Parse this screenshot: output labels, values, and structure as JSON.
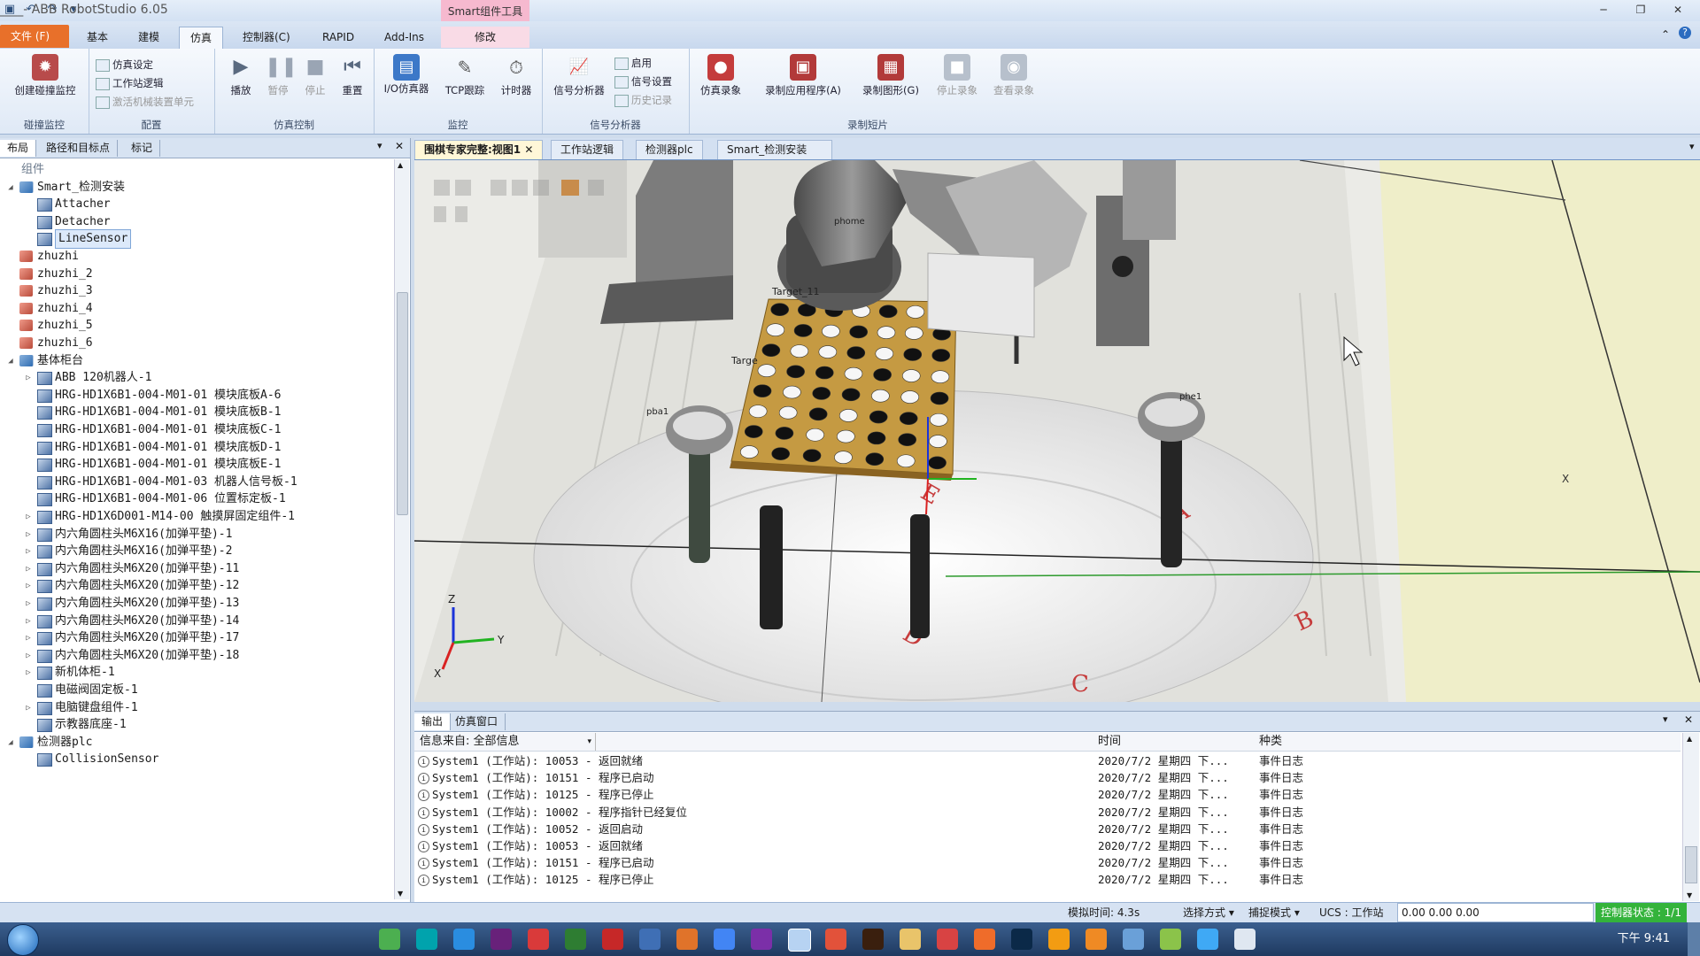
{
  "title_bar": {
    "doc_name": "________",
    "app_title": " - ABB RobotStudio 6.05",
    "context_group": "Smart组件工具",
    "quick_access": [
      "save-icon",
      "undo-icon",
      "redo-icon",
      "customize-icon"
    ]
  },
  "ribbon_tabs": [
    {
      "label": "文件 (F)"
    },
    {
      "label": "基本"
    },
    {
      "label": "建模"
    },
    {
      "label": "仿真"
    },
    {
      "label": "控制器(C)"
    },
    {
      "label": "RAPID"
    },
    {
      "label": "Add-Ins"
    },
    {
      "label": "修改"
    }
  ],
  "ribbon_groups": {
    "collision": {
      "label": "碰撞监控",
      "buttons": [
        "创建碰撞监控"
      ]
    },
    "config": {
      "label": "配置",
      "buttons": [
        "仿真设定",
        "工作站逻辑",
        "激活机械装置单元"
      ]
    },
    "sim_control": {
      "label": "仿真控制",
      "buttons": [
        "播放",
        "暂停",
        "停止",
        "重置"
      ]
    },
    "monitor": {
      "label": "监控",
      "buttons": [
        "I/O仿真器",
        "TCP跟踪",
        "计时器"
      ]
    },
    "signal": {
      "label": "信号分析器",
      "buttons": [
        "信号分析器",
        "启用",
        "信号设置",
        "历史记录"
      ]
    },
    "record": {
      "label": "录制短片",
      "buttons": [
        "仿真录象",
        "录制应用程序(A)",
        "录制图形(G)",
        "停止录象",
        "查看录象"
      ]
    }
  },
  "left_panel": {
    "tabs": [
      "布局",
      "路径和目标点",
      "标记"
    ],
    "tree": [
      {
        "label": "组件",
        "indent": 0,
        "exp": "",
        "icon": ""
      },
      {
        "label": "Smart_检测安装",
        "indent": 1,
        "exp": "◢",
        "icon": "grp"
      },
      {
        "label": "Attacher",
        "indent": 2,
        "exp": "",
        "icon": "comp"
      },
      {
        "label": "Detacher",
        "indent": 2,
        "exp": "",
        "icon": "comp"
      },
      {
        "label": "LineSensor",
        "indent": 2,
        "exp": "",
        "icon": "comp",
        "selected": true
      },
      {
        "label": "zhuzhi",
        "indent": 1,
        "exp": "",
        "icon": "part"
      },
      {
        "label": "zhuzhi_2",
        "indent": 1,
        "exp": "",
        "icon": "part"
      },
      {
        "label": "zhuzhi_3",
        "indent": 1,
        "exp": "",
        "icon": "part"
      },
      {
        "label": "zhuzhi_4",
        "indent": 1,
        "exp": "",
        "icon": "part"
      },
      {
        "label": "zhuzhi_5",
        "indent": 1,
        "exp": "",
        "icon": "part"
      },
      {
        "label": "zhuzhi_6",
        "indent": 1,
        "exp": "",
        "icon": "part"
      },
      {
        "label": "基体柜台",
        "indent": 1,
        "exp": "◢",
        "icon": "grp"
      },
      {
        "label": "ABB 120机器人-1",
        "indent": 2,
        "exp": "▷",
        "icon": "comp"
      },
      {
        "label": "HRG-HD1X6B1-004-M01-01 模块底板A-6",
        "indent": 2,
        "exp": "",
        "icon": "comp"
      },
      {
        "label": "HRG-HD1X6B1-004-M01-01 模块底板B-1",
        "indent": 2,
        "exp": "",
        "icon": "comp"
      },
      {
        "label": "HRG-HD1X6B1-004-M01-01 模块底板C-1",
        "indent": 2,
        "exp": "",
        "icon": "comp"
      },
      {
        "label": "HRG-HD1X6B1-004-M01-01 模块底板D-1",
        "indent": 2,
        "exp": "",
        "icon": "comp"
      },
      {
        "label": "HRG-HD1X6B1-004-M01-01 模块底板E-1",
        "indent": 2,
        "exp": "",
        "icon": "comp"
      },
      {
        "label": "HRG-HD1X6B1-004-M01-03 机器人信号板-1",
        "indent": 2,
        "exp": "",
        "icon": "comp"
      },
      {
        "label": "HRG-HD1X6B1-004-M01-06 位置标定板-1",
        "indent": 2,
        "exp": "",
        "icon": "comp"
      },
      {
        "label": "HRG-HD1X6D001-M14-00  触摸屏固定组件-1",
        "indent": 2,
        "exp": "▷",
        "icon": "comp"
      },
      {
        "label": "内六角圆柱头M6X16(加弹平垫)-1",
        "indent": 2,
        "exp": "▷",
        "icon": "comp"
      },
      {
        "label": "内六角圆柱头M6X16(加弹平垫)-2",
        "indent": 2,
        "exp": "▷",
        "icon": "comp"
      },
      {
        "label": "内六角圆柱头M6X20(加弹平垫)-11",
        "indent": 2,
        "exp": "▷",
        "icon": "comp"
      },
      {
        "label": "内六角圆柱头M6X20(加弹平垫)-12",
        "indent": 2,
        "exp": "▷",
        "icon": "comp"
      },
      {
        "label": "内六角圆柱头M6X20(加弹平垫)-13",
        "indent": 2,
        "exp": "▷",
        "icon": "comp"
      },
      {
        "label": "内六角圆柱头M6X20(加弹平垫)-14",
        "indent": 2,
        "exp": "▷",
        "icon": "comp"
      },
      {
        "label": "内六角圆柱头M6X20(加弹平垫)-17",
        "indent": 2,
        "exp": "▷",
        "icon": "comp"
      },
      {
        "label": "内六角圆柱头M6X20(加弹平垫)-18",
        "indent": 2,
        "exp": "▷",
        "icon": "comp"
      },
      {
        "label": "新机体柜-1",
        "indent": 2,
        "exp": "▷",
        "icon": "comp"
      },
      {
        "label": "电磁阀固定板-1",
        "indent": 2,
        "exp": "",
        "icon": "comp"
      },
      {
        "label": "电脑键盘组件-1",
        "indent": 2,
        "exp": "▷",
        "icon": "comp"
      },
      {
        "label": "示教器底座-1",
        "indent": 2,
        "exp": "",
        "icon": "comp"
      },
      {
        "label": "检测器plc",
        "indent": 1,
        "exp": "◢",
        "icon": "grp"
      },
      {
        "label": "CollisionSensor",
        "indent": 2,
        "exp": "",
        "icon": "comp"
      }
    ]
  },
  "doc_tabs": [
    {
      "label": "围棋专家完整:视图1",
      "active": true
    },
    {
      "label": "工作站逻辑"
    },
    {
      "label": "检测器plc"
    },
    {
      "label": "Smart_检测安装"
    }
  ],
  "viewport": {
    "labels": {
      "phome": "phome",
      "target11": "Target_11",
      "target": "Targe",
      "pba1": "pba1",
      "phe1": "phe1"
    },
    "board_letters": [
      "A",
      "B",
      "C",
      "D",
      "E"
    ],
    "axes": {
      "z": "Z",
      "y": "Y",
      "x": "X"
    }
  },
  "output_panel": {
    "tabs": [
      "输出",
      "仿真窗口"
    ],
    "filter_label": "信息来自: 全部信息",
    "columns": [
      "时间",
      "种类"
    ],
    "rows": [
      {
        "msg": "System1 (工作站): 10053 - 返回就绪",
        "time": "2020/7/2 星期四 下...",
        "kind": "事件日志"
      },
      {
        "msg": "System1 (工作站): 10151 - 程序已启动",
        "time": "2020/7/2 星期四 下...",
        "kind": "事件日志"
      },
      {
        "msg": "System1 (工作站): 10125 - 程序已停止",
        "time": "2020/7/2 星期四 下...",
        "kind": "事件日志"
      },
      {
        "msg": "System1 (工作站): 10002 - 程序指针已经复位",
        "time": "2020/7/2 星期四 下...",
        "kind": "事件日志"
      },
      {
        "msg": "System1 (工作站): 10052 - 返回启动",
        "time": "2020/7/2 星期四 下...",
        "kind": "事件日志"
      },
      {
        "msg": "System1 (工作站): 10053 - 返回就绪",
        "time": "2020/7/2 星期四 下...",
        "kind": "事件日志"
      },
      {
        "msg": "System1 (工作站): 10151 - 程序已启动",
        "time": "2020/7/2 星期四 下...",
        "kind": "事件日志"
      },
      {
        "msg": "System1 (工作站): 10125 - 程序已停止",
        "time": "2020/7/2 星期四 下...",
        "kind": "事件日志"
      }
    ]
  },
  "status_bar": {
    "sim_time": "模拟时间: 4.3s",
    "select_mode": "选择方式",
    "snap_mode": "捕捉模式",
    "ucs": "UCS : 工作站",
    "coords": "0.00   0.00   0.00",
    "controller_status": "控制器状态 : 1/1"
  },
  "taskbar": {
    "clock": "下午 9:41"
  }
}
